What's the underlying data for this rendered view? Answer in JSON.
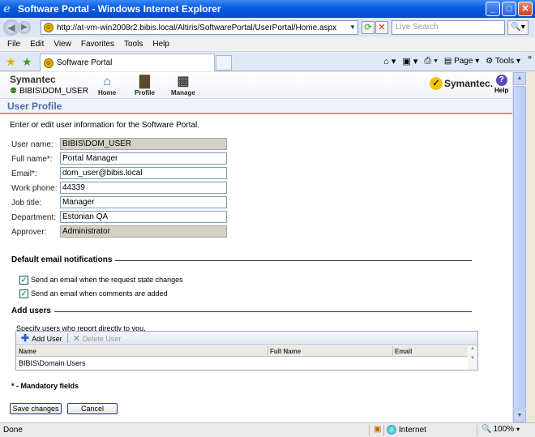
{
  "window": {
    "title": "Software Portal - Windows Internet Explorer",
    "minimize": "_",
    "maximize": "□",
    "close": "✕"
  },
  "address": {
    "url": "http://at-vm-win2008r2.bibis.local/Altiris/SoftwarePortal/UserPortal/Home.aspx",
    "search_placeholder": "Live Search"
  },
  "menu": [
    "File",
    "Edit",
    "View",
    "Favorites",
    "Tools",
    "Help"
  ],
  "tab": {
    "label": "Software Portal"
  },
  "toolbar": {
    "page_label": "Page",
    "tools_label": "Tools"
  },
  "portal": {
    "brand": "Symantec",
    "user": "BIBIS\\DOM_USER",
    "nav": [
      {
        "label": "Home",
        "icon": "home-icon"
      },
      {
        "label": "Profile",
        "icon": "profile-icon"
      },
      {
        "label": "Manage",
        "icon": "manage-icon"
      }
    ],
    "logo_text": "Symantec.",
    "help_label": "Help"
  },
  "page": {
    "title": "User Profile",
    "intro": "Enter or edit user information for the Software Portal."
  },
  "form": {
    "fields": [
      {
        "label": "User name:",
        "value": "BIBIS\\DOM_USER",
        "readonly": true
      },
      {
        "label": "Full name*:",
        "value": "Portal Manager",
        "readonly": false
      },
      {
        "label": "Email*:",
        "value": "dom_user@bibis.local",
        "readonly": false
      },
      {
        "label": "Work phone:",
        "value": "44339",
        "readonly": false
      },
      {
        "label": "Job title:",
        "value": "Manager",
        "readonly": false
      },
      {
        "label": "Department:",
        "value": "Estonian QA",
        "readonly": false
      },
      {
        "label": "Approver:",
        "value": "Administrator",
        "readonly": true
      }
    ]
  },
  "notifications": {
    "title": "Default email notifications",
    "options": [
      {
        "label": "Send an email when the request state changes",
        "checked": true
      },
      {
        "label": "Send an email when comments are added",
        "checked": true
      }
    ]
  },
  "add_users": {
    "title": "Add users",
    "hint": "Specify users who report directly to you.",
    "add_label": "Add User",
    "delete_label": "Delete User",
    "columns": [
      "Name",
      "Full Name",
      "Email"
    ],
    "rows": [
      {
        "name": "BIBIS\\Domain Users",
        "full_name": "",
        "email": ""
      }
    ]
  },
  "mandatory": "* - Mandatory fields",
  "buttons": {
    "save": "Save changes",
    "cancel": "Cancel"
  },
  "status": {
    "text": "Done",
    "zone": "Internet",
    "zoom": "100%"
  }
}
